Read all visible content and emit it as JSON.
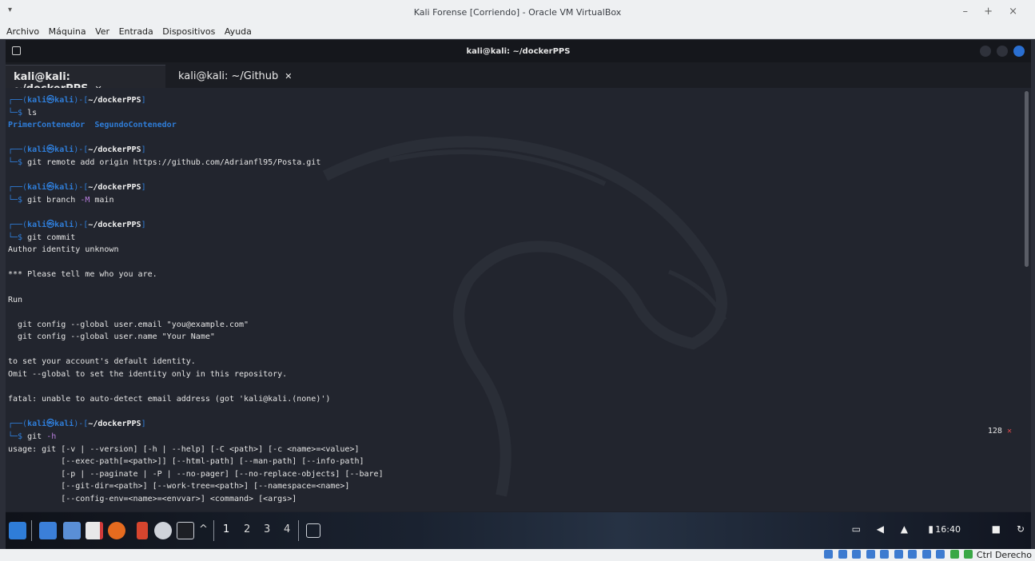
{
  "vbox": {
    "title": "Kali Forense [Corriendo] - Oracle VM VirtualBox",
    "menu": [
      "Archivo",
      "Máquina",
      "Ver",
      "Entrada",
      "Dispositivos",
      "Ayuda"
    ],
    "host_key": "Ctrl Derecho"
  },
  "terminal": {
    "window_title": "kali@kali: ~/dockerPPS",
    "tabs": [
      {
        "label": "kali@kali: ~/dockerPPS",
        "active": true
      },
      {
        "label": "kali@kali: ~/Github",
        "active": false
      }
    ],
    "prompt": {
      "user_host": "kali㉿kali",
      "path": "~/dockerPPS"
    },
    "ls_cmd": "ls",
    "ls_out": [
      "PrimerContenedor",
      "SegundoContenedor"
    ],
    "cmd_remote": "git remote add origin https://github.com/Adrianfl95/Posta.git",
    "cmd_branch_pre": "git branch ",
    "cmd_branch_opt": "-M",
    "cmd_branch_post": " main",
    "cmd_commit": "git commit",
    "commit_out": [
      "Author identity unknown",
      "",
      "*** Please tell me who you are.",
      "",
      "Run",
      "",
      "  git config --global user.email \"you@example.com\"",
      "  git config --global user.name \"Your Name\"",
      "",
      "to set your account's default identity.",
      "Omit --global to set the identity only in this repository.",
      "",
      "fatal: unable to auto-detect email address (got 'kali@kali.(none)')"
    ],
    "cmd_help_pre": "git ",
    "cmd_help_opt": "-h",
    "help_out": [
      "usage: git [-v | --version] [-h | --help] [-C <path>] [-c <name>=<value>]",
      "           [--exec-path[=<path>]] [--html-path] [--man-path] [--info-path]",
      "           [-p | --paginate | -P | --no-pager] [--no-replace-objects] [--bare]",
      "           [--git-dir=<path>] [--work-tree=<path>] [--namespace=<name>]",
      "           [--config-env=<name>=<envvar>] <command> [<args>]"
    ],
    "exit_code": "128",
    "exit_mark": "✕"
  },
  "panel": {
    "workspaces": [
      "1",
      "2",
      "3",
      "4"
    ],
    "clock": "16:40"
  },
  "colors": {
    "accent": "#2f7dd8",
    "bg": "#22252e"
  }
}
